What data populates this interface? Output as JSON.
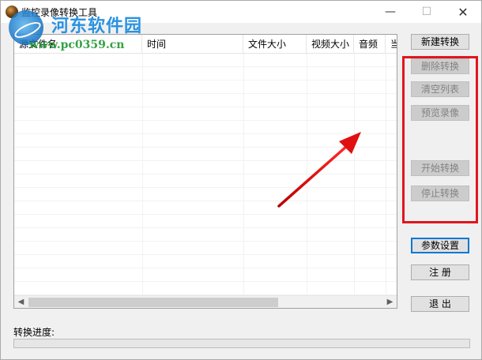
{
  "window": {
    "title": "监控录像转换工具",
    "min_symbol": "—",
    "max_symbol": "☐",
    "close_symbol": "✕"
  },
  "watermark": {
    "name": "河东软件园",
    "url": "www.pc0359.cn"
  },
  "table": {
    "columns": [
      "源文件名",
      "时间",
      "文件大小",
      "视频大小",
      "音频",
      "当"
    ],
    "rows": []
  },
  "buttons": {
    "new_convert": "新建转换",
    "delete_convert": "删除转换",
    "clear_list": "清空列表",
    "preview_video": "预览录像",
    "start_convert": "开始转换",
    "stop_convert": "停止转换",
    "settings": "参数设置",
    "register": "注 册",
    "exit": "退 出"
  },
  "progress": {
    "label": "转换进度:",
    "value": 0
  },
  "colors": {
    "highlight": "#e0161e",
    "accent": "#0078d7"
  }
}
